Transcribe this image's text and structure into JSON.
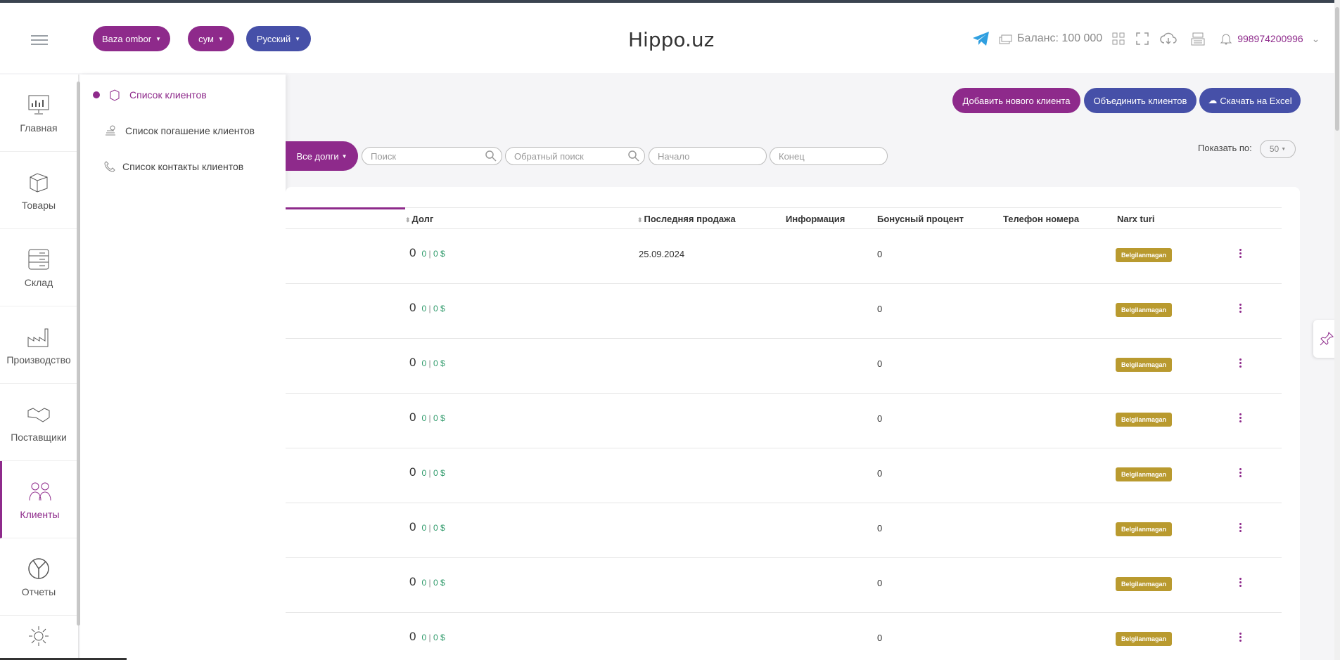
{
  "header": {
    "warehouse_label": "Baza ombor",
    "currency_label": "сум",
    "language_label": "Русский",
    "brand": "Hippo.uz",
    "balance": "Баланс: 100 000",
    "phone": "998974200996"
  },
  "sidebar": {
    "items": [
      {
        "label": "Главная",
        "icon": "dashboard-icon"
      },
      {
        "label": "Товары",
        "icon": "box-icon"
      },
      {
        "label": "Склад",
        "icon": "warehouse-icon"
      },
      {
        "label": "Производство",
        "icon": "factory-icon"
      },
      {
        "label": "Поставщики",
        "icon": "handshake-icon"
      },
      {
        "label": "Клиенты",
        "icon": "users-icon"
      },
      {
        "label": "Отчеты",
        "icon": "chart-pie-icon"
      }
    ]
  },
  "submenu": {
    "items": [
      {
        "label": "Список клиентов"
      },
      {
        "label": "Список погашение клиентов"
      },
      {
        "label": "Список контакты клиентов"
      }
    ]
  },
  "actions": {
    "add_client": "Добавить нового клиента",
    "merge_clients": "Объединить клиентов",
    "download_excel": "Скачать на Excel"
  },
  "filters": {
    "debt_filter": "Все долги",
    "search_placeholder": "Поиск",
    "reverse_search_placeholder": "Обратный поиск",
    "start_placeholder": "Начало",
    "end_placeholder": "Конец",
    "show_by_label": "Показать по:",
    "show_by_value": "50"
  },
  "table": {
    "headers": {
      "debt": "Долг",
      "last_sale": "Последняя продажа",
      "info": "Информация",
      "bonus": "Бонусный процент",
      "phone": "Телефон номера",
      "price_type": "Narx turi"
    },
    "rows": [
      {
        "debt": "0",
        "debt_a": "0",
        "debt_b": "0 $",
        "last_sale": "25.09.2024",
        "bonus": "0",
        "price_type": "Belgilanmagan"
      },
      {
        "debt": "0",
        "debt_a": "0",
        "debt_b": "0 $",
        "last_sale": "",
        "bonus": "0",
        "price_type": "Belgilanmagan"
      },
      {
        "debt": "0",
        "debt_a": "0",
        "debt_b": "0 $",
        "last_sale": "",
        "bonus": "0",
        "price_type": "Belgilanmagan"
      },
      {
        "debt": "0",
        "debt_a": "0",
        "debt_b": "0 $",
        "last_sale": "",
        "bonus": "0",
        "price_type": "Belgilanmagan"
      },
      {
        "debt": "0",
        "debt_a": "0",
        "debt_b": "0 $",
        "last_sale": "",
        "bonus": "0",
        "price_type": "Belgilanmagan"
      },
      {
        "debt": "0",
        "debt_a": "0",
        "debt_b": "0 $",
        "last_sale": "",
        "bonus": "0",
        "price_type": "Belgilanmagan"
      },
      {
        "debt": "0",
        "debt_a": "0",
        "debt_b": "0 $",
        "last_sale": "",
        "bonus": "0",
        "price_type": "Belgilanmagan"
      },
      {
        "debt": "0",
        "debt_a": "0",
        "debt_b": "0 $",
        "last_sale": "",
        "bonus": "0",
        "price_type": "Belgilanmagan"
      }
    ]
  },
  "colors": {
    "primary": "#8e2a8b",
    "secondary": "#4650a8",
    "badge": "#b99a2f",
    "success": "#2e9a6a"
  }
}
